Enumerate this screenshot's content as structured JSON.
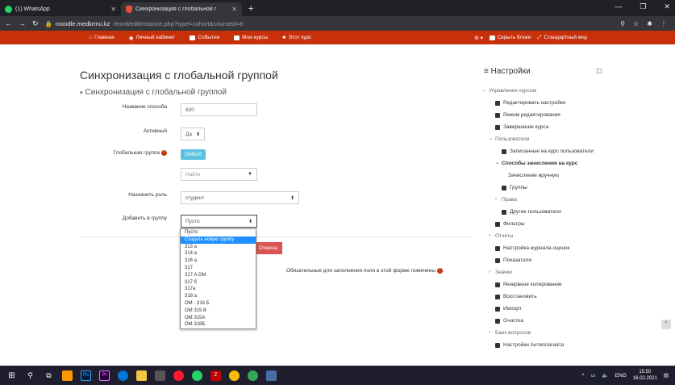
{
  "browser": {
    "tabs": [
      {
        "title": "(1) WhatsApp",
        "active": false
      },
      {
        "title": "Синхронизация с глобальной г",
        "active": true
      }
    ],
    "url_host": "moodle.medkrmu.kz",
    "url_path": "/enrol/editinstance.php?type=cohort&courseid=6"
  },
  "nav": {
    "items": [
      "Главная",
      "Личный кабинет",
      "События",
      "Мои курсы",
      "Этот курс"
    ],
    "right_items": [
      "Скрыть блоки",
      "Стандартный вид"
    ]
  },
  "page": {
    "title": "Синхронизация с глобальной группой",
    "section": "Синхронизация с глобальной группой"
  },
  "form": {
    "name_label": "Название способа",
    "name_value": "620",
    "active_label": "Активный",
    "active_value": "Да",
    "cohort_label": "Глобальная группа",
    "cohort_chip": "OM620",
    "search_placeholder": "Найти",
    "role_label": "Назначить роль",
    "role_value": "студент",
    "group_label": "Добавить в группу",
    "group_value": "Пусто",
    "cancel_label": "Отмена",
    "required_note": "Обязательные для заполнения поля в этой форме помечены"
  },
  "dropdown_options": [
    "Пусто",
    "Создать новую группу",
    "313 a",
    "314 a",
    "316 a",
    "317",
    "317 A OM",
    "317 б",
    "317a",
    "318 a",
    "OM - 316 Б",
    "OM 315 B",
    "OM 315A",
    "OM 318Б"
  ],
  "dropdown_selected_index": 1,
  "settings": {
    "title": "Настройки",
    "items": [
      {
        "label": "Управление курсом",
        "marker": "⌄",
        "indent": 0,
        "style": "gray"
      },
      {
        "label": "Редактировать настройки",
        "marker": "",
        "indent": 1,
        "style": "",
        "icon": "gear-icon"
      },
      {
        "label": "Режим редактирования",
        "marker": "",
        "indent": 1,
        "style": "",
        "icon": "pencil-icon"
      },
      {
        "label": "Завершение курса",
        "marker": "",
        "indent": 1,
        "style": "",
        "icon": "gear-icon"
      },
      {
        "label": "Пользователи",
        "marker": "⌄",
        "indent": 1,
        "style": "gray"
      },
      {
        "label": "Записанные на курс пользователи",
        "marker": "",
        "indent": 2,
        "style": "",
        "icon": "users-icon"
      },
      {
        "label": "Способы зачисления на курс",
        "marker": "⌄",
        "indent": 2,
        "style": "bold"
      },
      {
        "label": "Зачисление вручную",
        "marker": "",
        "indent": 3,
        "style": ""
      },
      {
        "label": "Группы",
        "marker": "",
        "indent": 2,
        "style": "",
        "icon": "group-icon"
      },
      {
        "label": "Права",
        "marker": "›",
        "indent": 2,
        "style": "gray"
      },
      {
        "label": "Другие пользователи",
        "marker": "",
        "indent": 2,
        "style": "",
        "icon": "users-icon"
      },
      {
        "label": "Фильтры",
        "marker": "",
        "indent": 1,
        "style": "",
        "icon": "filter-icon"
      },
      {
        "label": "Отчеты",
        "marker": "›",
        "indent": 1,
        "style": "gray"
      },
      {
        "label": "Настройка журнала оценок",
        "marker": "",
        "indent": 1,
        "style": "",
        "icon": "gear-icon"
      },
      {
        "label": "Показатели",
        "marker": "",
        "indent": 1,
        "style": "",
        "icon": "chart-icon"
      },
      {
        "label": "Значки",
        "marker": "›",
        "indent": 1,
        "style": "gray"
      },
      {
        "label": "Резервное копирование",
        "marker": "",
        "indent": 1,
        "style": "",
        "icon": "file-icon"
      },
      {
        "label": "Восстановить",
        "marker": "",
        "indent": 1,
        "style": "",
        "icon": "upload-icon"
      },
      {
        "label": "Импорт",
        "marker": "",
        "indent": 1,
        "style": "",
        "icon": "upload-icon"
      },
      {
        "label": "Очистка",
        "marker": "",
        "indent": 1,
        "style": "",
        "icon": "arrow-left-icon"
      },
      {
        "label": "Банк вопросов",
        "marker": "›",
        "indent": 1,
        "style": "gray"
      },
      {
        "label": "Настройки Антиплагиата",
        "marker": "",
        "indent": 1,
        "style": "",
        "icon": "chart-icon"
      }
    ]
  },
  "taskbar": {
    "lang": "ENG",
    "time": "15:50",
    "date": "16.02.2021"
  },
  "colors": {
    "nav": "#c8300a",
    "chip": "#5bc0de",
    "cancel": "#d9534f",
    "selected_option": "#1e90ff"
  }
}
